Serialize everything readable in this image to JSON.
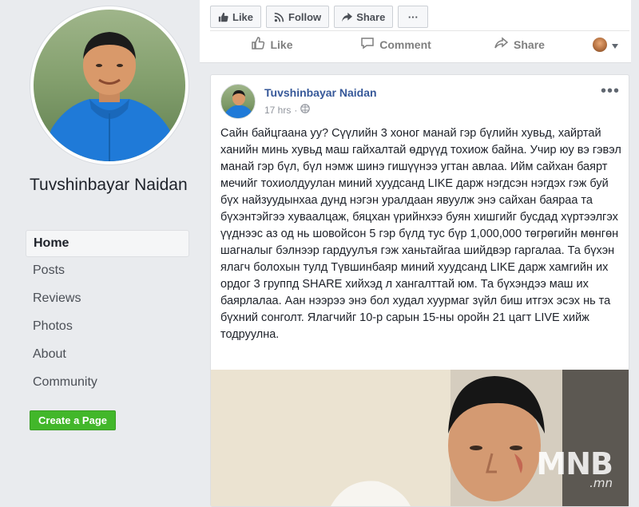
{
  "profile": {
    "name": "Tuvshinbayar Naidan"
  },
  "nav": {
    "items": [
      {
        "label": "Home",
        "active": true
      },
      {
        "label": "Posts",
        "active": false
      },
      {
        "label": "Reviews",
        "active": false
      },
      {
        "label": "Photos",
        "active": false
      },
      {
        "label": "About",
        "active": false
      },
      {
        "label": "Community",
        "active": false
      }
    ],
    "create_page_label": "Create a Page"
  },
  "page_actions": {
    "like_label": "Like",
    "follow_label": "Follow",
    "share_label": "Share",
    "more_label": "···"
  },
  "reactions": {
    "like_label": "Like",
    "comment_label": "Comment",
    "share_label": "Share"
  },
  "post": {
    "author": "Tuvshinbayar Naidan",
    "time": "17 hrs",
    "menu_label": "•••",
    "text": "Сайн байцгаана уу? Сүүлийн 3 хоног манай гэр бүлийн хувьд, хайртай ханийн минь хувьд маш гайхалтай өдрүүд тохиож байна. Учир юу вэ гэвэл манай гэр бүл, бүл нэмж шинэ гишүүнээ угтан авлаа. Ийм сайхан баярт мечийг тохиолдуулан миний хуудсанд LIKE дарж нэгдсэн нэгдэх гэж буй бүх найзуудынхаа дунд нэгэн уралдаан явуулж энэ сайхан баяраа та бүхэнтэйгээ хуваалцаж, бяцхан үрийнхээ буян хишгийг бусдад хүртээлгэх үүднээс аз од нь шовойсон 5 гэр бүлд тус бүр 1,000,000 төгрөгийн мөнгөн шагналыг бэлнээр гардуулъя гэж ханьтайгаа шийдвэр гаргалаа. Та бүхэн ялагч болохын тулд Түвшинбаяр миний хуудсанд LIKE дарж хамгийн их ордог 3 группд SHARE хийхэд л хангалттай юм. Та бүхэндээ маш их баярлалаа. Аан нээрээ энэ бол худал хуурмаг зүйл биш итгэх эсэх нь та бүхний сонголт. Ялагчийг 10-р сарын 15-ны оройн 21 цагт LIVE хийж тодруулна."
  },
  "watermark": {
    "main": "MNB",
    "sub": ".mn"
  },
  "colors": {
    "page_bg": "#e9ebee",
    "link_blue": "#365899",
    "create_green": "#42b72a",
    "sweater_blue": "#1f7ad8"
  }
}
